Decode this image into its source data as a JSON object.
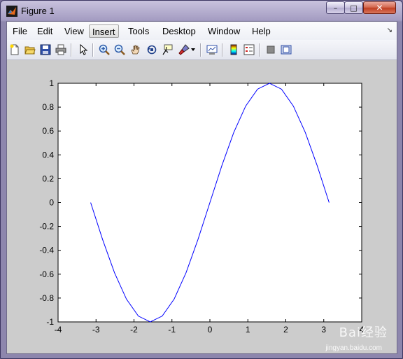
{
  "window": {
    "title": "Figure 1",
    "controls": {
      "minimize": "–",
      "maximize": "□",
      "close": "✕"
    }
  },
  "menubar": {
    "items": [
      "File",
      "Edit",
      "View",
      "Insert",
      "Tools",
      "Desktop",
      "Window",
      "Help"
    ],
    "active": "Insert",
    "dock_glyph": "↘"
  },
  "toolbar": {
    "icons": [
      "new-figure-icon",
      "open-file-icon",
      "save-icon",
      "print-icon",
      "edit-plot-arrow-icon",
      "zoom-in-icon",
      "zoom-out-icon",
      "pan-hand-icon",
      "rotate-3d-icon",
      "data-cursor-icon",
      "brush-icon",
      "link-plot-icon",
      "colorbar-icon",
      "legend-icon",
      "hide-plot-tools-icon",
      "show-plot-tools-icon"
    ]
  },
  "colors": {
    "line": "#0000ff",
    "axes_bg": "#ffffff",
    "figure_bg": "#cccccc"
  },
  "watermark": {
    "text": "Bai经验",
    "url": "jingyan.baidu.com"
  },
  "chart_data": {
    "type": "line",
    "title": "",
    "xlabel": "",
    "ylabel": "",
    "xlim": [
      -4,
      4
    ],
    "ylim": [
      -1,
      1
    ],
    "xticks": [
      -4,
      -3,
      -2,
      -1,
      0,
      1,
      2,
      3,
      4
    ],
    "yticks": [
      -1,
      -0.8,
      -0.6,
      -0.4,
      -0.2,
      0,
      0.2,
      0.4,
      0.6,
      0.8,
      1
    ],
    "xtick_labels": [
      "-4",
      "-3",
      "-2",
      "-1",
      "0",
      "1",
      "2",
      "3",
      "4"
    ],
    "ytick_labels": [
      "-1",
      "-0.8",
      "-0.6",
      "-0.4",
      "-0.2",
      "0",
      "0.2",
      "0.4",
      "0.6",
      "0.8",
      "1"
    ],
    "grid": false,
    "series": [
      {
        "x": [
          -3.1416,
          -2.8274,
          -2.5133,
          -2.1991,
          -1.885,
          -1.5708,
          -1.2566,
          -0.9425,
          -0.6283,
          -0.3142,
          0,
          0.3142,
          0.6283,
          0.9425,
          1.2566,
          1.5708,
          1.885,
          2.1991,
          2.5133,
          2.8274,
          3.1416
        ],
        "y": [
          0,
          -0.309,
          -0.5878,
          -0.809,
          -0.9511,
          -1,
          -0.9511,
          -0.809,
          -0.5878,
          -0.309,
          0,
          0.309,
          0.5878,
          0.809,
          0.9511,
          1,
          0.9511,
          0.809,
          0.5878,
          0.309,
          0
        ]
      }
    ]
  }
}
